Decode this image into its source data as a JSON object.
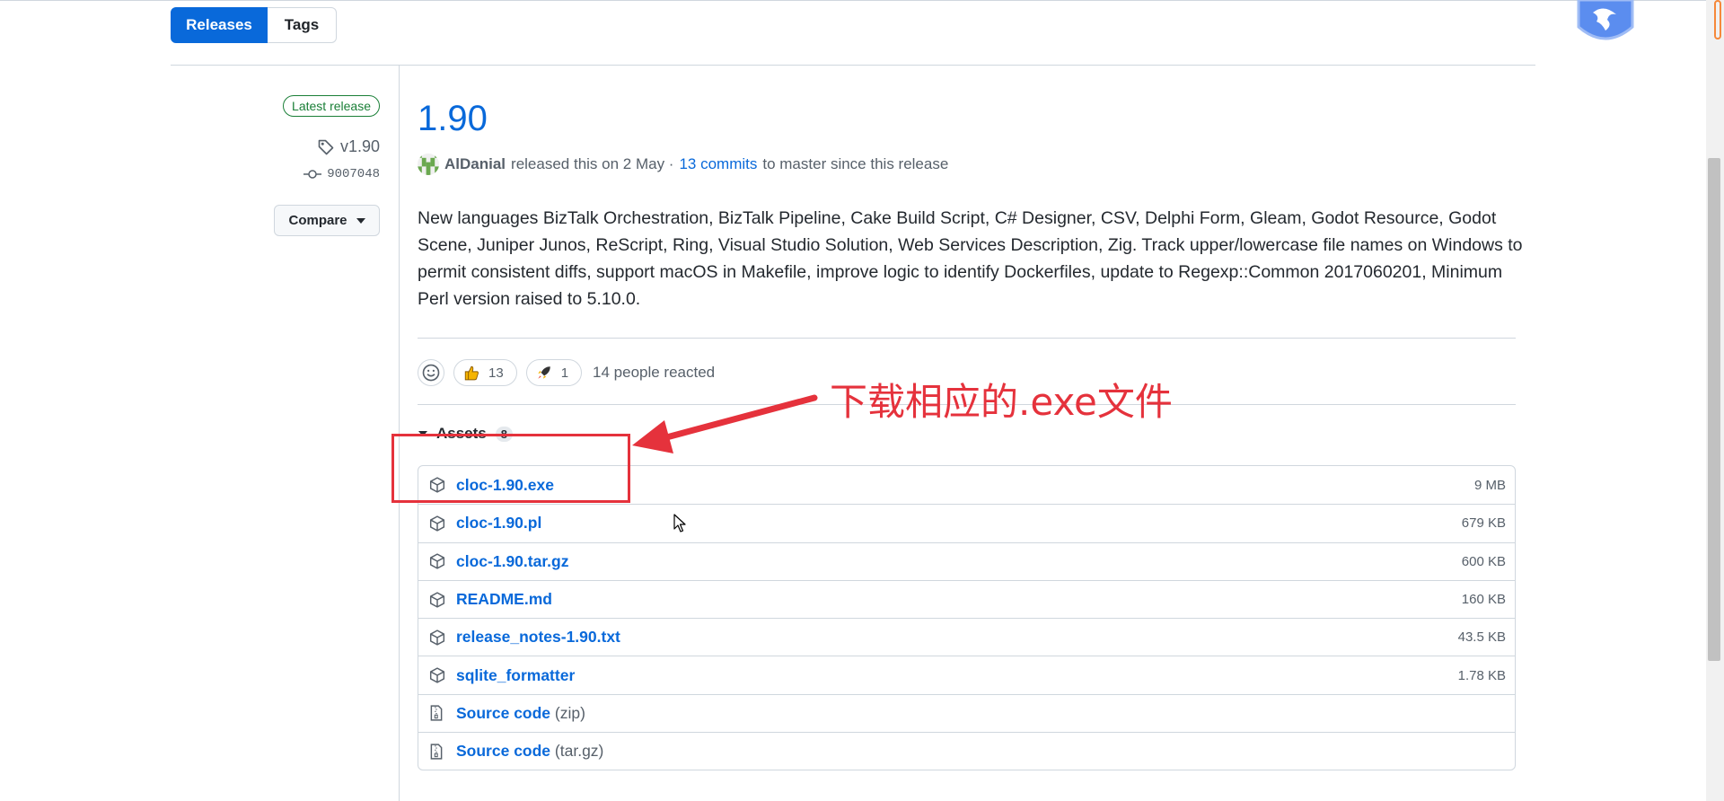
{
  "subnav": {
    "releases_label": "Releases",
    "tags_label": "Tags"
  },
  "sidebar": {
    "latest_badge": "Latest release",
    "tag": "v1.90",
    "commit": "9007048",
    "compare_label": "Compare"
  },
  "release": {
    "title": "1.90",
    "author": "AlDanial",
    "released_text": "released this on 2 May ·",
    "commits_link": "13 commits",
    "since_text": "to master since this release",
    "body": "New languages BizTalk Orchestration, BizTalk Pipeline, Cake Build Script, C# Designer, CSV, Delphi Form, Gleam, Godot Resource, Godot Scene, Juniper Junos, ReScript, Ring, Visual Studio Solution, Web Services Description, Zig. Track upper/lowercase file names on Windows to permit consistent diffs, support macOS in Makefile, improve logic to identify Dockerfiles, update to Regexp::Common 2017060201, Minimum Perl version raised to 5.10.0."
  },
  "reactions": {
    "thumbs_count": "13",
    "rocket_count": "1",
    "reacted_text": "14 people reacted"
  },
  "assets": {
    "heading": "Assets",
    "count": "8",
    "files": [
      {
        "name": "cloc-1.90.exe",
        "size": "9 MB"
      },
      {
        "name": "cloc-1.90.pl",
        "size": "679 KB"
      },
      {
        "name": "cloc-1.90.tar.gz",
        "size": "600 KB"
      },
      {
        "name": "README.md",
        "size": "160 KB"
      },
      {
        "name": "release_notes-1.90.txt",
        "size": "43.5 KB"
      },
      {
        "name": "sqlite_formatter",
        "size": "1.78 KB"
      }
    ],
    "sources": [
      {
        "label": "Source code",
        "format": "(zip)"
      },
      {
        "label": "Source code",
        "format": "(tar.gz)"
      }
    ]
  },
  "annotation": {
    "text": "下载相应的.exe文件",
    "color": "#e5323c"
  },
  "colors": {
    "accent": "#0969da",
    "success": "#1a7f37",
    "border": "#d0d7de",
    "muted": "#57606a"
  }
}
